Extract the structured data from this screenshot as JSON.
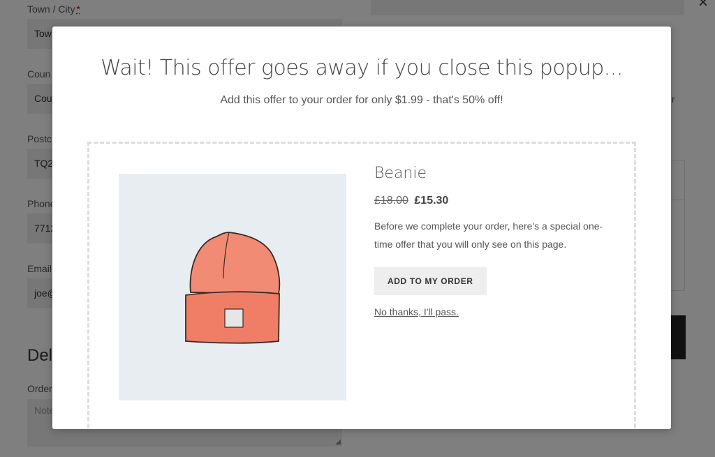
{
  "background_form": {
    "town_label": "Town / City",
    "required_mark": "*",
    "town_value": "Tow",
    "country_label": "Coun",
    "country_value": "Cou",
    "postcode_label": "Postc",
    "postcode_value": "TQ2",
    "phone_label": "Phone",
    "phone_value": "7712",
    "email_label": "Email",
    "email_value": "joe@",
    "delivery_heading": "Del",
    "order_notes_label": "Order",
    "order_notes_placeholder": "Note",
    "right_fragment_text": "ır"
  },
  "popup": {
    "title": "Wait! This offer goes away if you close this popup...",
    "subtitle": "Add this offer to your order for only $1.99 - that's 50% off!",
    "product": {
      "name": "Beanie",
      "price_old": "£18.00",
      "price_new": "£15.30",
      "description": "Before we complete your order, here's a special one-time offer that you will only see on this page.",
      "image_icon": "beanie-hat-illustration"
    },
    "add_button_label": "Add to my order",
    "decline_link_label": "No thanks, I'll pass."
  },
  "colors": {
    "overlay": "rgba(0,0,0,0.5)",
    "beanie": "#f28b74",
    "image_bg": "#e8edf2",
    "button_bg": "#eeeeee"
  }
}
